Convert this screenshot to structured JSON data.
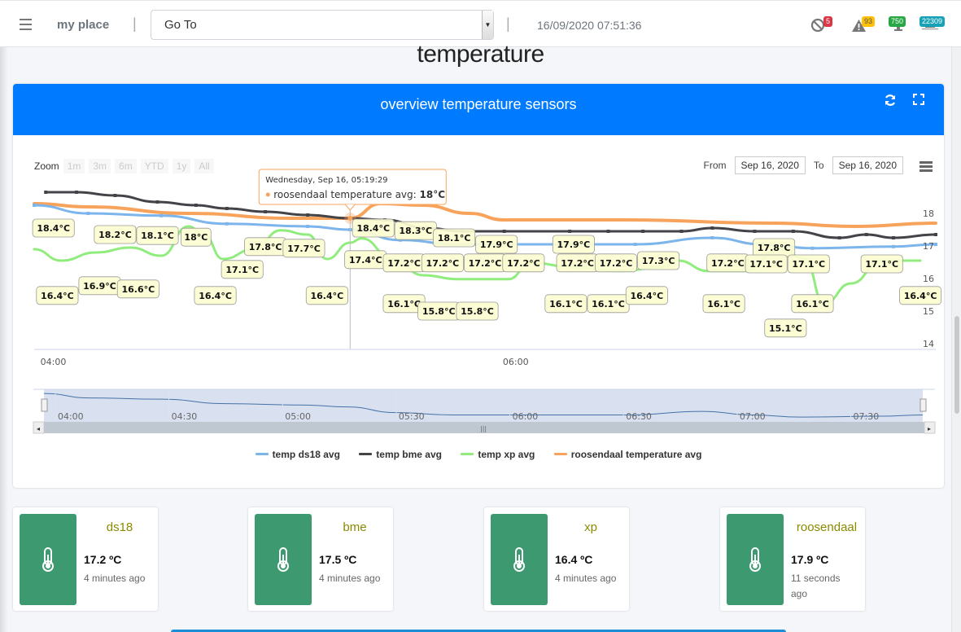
{
  "topbar": {
    "brand": "my place",
    "separator": "|",
    "goto_value": "Go To",
    "clock": "16/09/2020 07:51:36",
    "indicators": [
      {
        "icon": "ban-icon",
        "count": "5",
        "color": "#dc3545"
      },
      {
        "icon": "warning-icon",
        "count": "93",
        "color": "#ffc107"
      },
      {
        "icon": "node-icon",
        "count": "750",
        "color": "#28a745"
      },
      {
        "icon": "monitor-icon",
        "count": "22309",
        "color": "#17a2b8"
      }
    ]
  },
  "page": {
    "title": "temperature"
  },
  "panel": {
    "title": "overview temperature sensors",
    "zoom_label": "Zoom",
    "zoom_buttons": [
      "1m",
      "3m",
      "6m",
      "YTD",
      "1y",
      "All"
    ],
    "from_label": "From",
    "from_value": "Sep 16, 2020",
    "to_label": "To",
    "to_value": "Sep 16, 2020"
  },
  "tooltip": {
    "header": "Wednesday, Sep 16, 05:19:29",
    "series": "roosendaal temperature avg: ",
    "value": "18°C",
    "time": "05:19"
  },
  "chart_data": {
    "type": "line",
    "title": "overview temperature sensors",
    "xlabel": "",
    "ylabel": "",
    "x_range": [
      "03:55",
      "07:49"
    ],
    "x_ticks": [
      "04:00",
      "06:00"
    ],
    "ylim": [
      14,
      18.8
    ],
    "y_ticks": [
      14,
      15,
      16,
      17,
      18
    ],
    "grid": false,
    "legend_position": "bottom-center",
    "navigator_ticks": [
      "04:00",
      "04:30",
      "05:00",
      "05:30",
      "06:00",
      "06:30",
      "07:00",
      "07:30"
    ],
    "series": [
      {
        "name": "temp ds18 avg",
        "color": "#7cb5ec",
        "x": [
          "03:55",
          "04:09",
          "04:28",
          "04:45",
          "05:06",
          "05:17",
          "05:30",
          "05:45",
          "05:58",
          "06:31",
          "06:51",
          "07:04",
          "07:17",
          "07:38",
          "07:49"
        ],
        "values": [
          18.25,
          18.0,
          17.93,
          17.68,
          17.6,
          17.5,
          17.18,
          17.05,
          17.05,
          17.05,
          17.25,
          17.05,
          16.93,
          16.98,
          17.05
        ]
      },
      {
        "name": "temp bme avg",
        "color": "#434348",
        "x": [
          "03:58",
          "04:06",
          "04:16",
          "04:27",
          "04:37",
          "04:45",
          "04:55",
          "05:06",
          "05:17",
          "05:26",
          "05:37",
          "05:46",
          "05:57",
          "06:14",
          "06:24",
          "06:33",
          "06:43",
          "06:51",
          "07:02",
          "07:12",
          "07:24",
          "07:31",
          "07:38",
          "07:49"
        ],
        "values": [
          18.65,
          18.65,
          18.55,
          18.35,
          18.25,
          18.15,
          18.05,
          17.95,
          17.85,
          17.8,
          17.55,
          17.45,
          17.45,
          17.45,
          17.45,
          17.45,
          17.45,
          17.55,
          17.45,
          17.45,
          17.25,
          17.35,
          17.25,
          17.35
        ]
      },
      {
        "name": "temp xp avg",
        "color": "#90ed7d",
        "x": [
          "03:55",
          "04:02",
          "04:11",
          "04:20",
          "04:28",
          "04:35",
          "04:39",
          "04:44",
          "04:52",
          "04:59",
          "05:06",
          "05:11",
          "05:17",
          "05:20",
          "05:28",
          "05:36",
          "05:45",
          "05:58",
          "06:04",
          "06:15",
          "06:27",
          "06:38",
          "06:42",
          "06:50",
          "06:59",
          "07:09",
          "07:15",
          "07:20",
          "07:27",
          "07:35",
          "07:45"
        ],
        "values": [
          16.9,
          16.55,
          16.8,
          16.95,
          16.7,
          17.6,
          17.35,
          16.6,
          16.9,
          17.48,
          17.35,
          16.6,
          17.1,
          17.23,
          16.6,
          16.1,
          15.98,
          15.98,
          16.48,
          16.35,
          16.23,
          16.35,
          16.55,
          16.23,
          16.23,
          16.9,
          16.6,
          15.23,
          15.85,
          16.55,
          16.55
        ]
      },
      {
        "name": "roosendaal temperature avg",
        "color": "#f7a35c",
        "x": [
          "03:55",
          "04:09",
          "04:35",
          "05:02",
          "05:17",
          "05:25",
          "05:36",
          "05:48",
          "05:57",
          "06:28",
          "07:07",
          "07:28",
          "07:49"
        ],
        "values": [
          18.3,
          18.2,
          18.0,
          17.85,
          17.85,
          18.3,
          18.25,
          18.0,
          17.8,
          17.8,
          17.7,
          17.6,
          17.7
        ]
      }
    ],
    "data_labels": [
      {
        "text": "18.4°C",
        "x": "04:00",
        "v": 17.55
      },
      {
        "text": "18.2°C",
        "x": "04:16",
        "v": 17.35
      },
      {
        "text": "18.1°C",
        "x": "04:27",
        "v": 17.32
      },
      {
        "text": "18°C",
        "x": "04:37",
        "v": 17.27
      },
      {
        "text": "17.8°C",
        "x": "04:55",
        "v": 16.98
      },
      {
        "text": "17.7°C",
        "x": "05:05",
        "v": 16.93
      },
      {
        "text": "18.4°C",
        "x": "05:23",
        "v": 17.55
      },
      {
        "text": "18.3°C",
        "x": "05:34",
        "v": 17.47
      },
      {
        "text": "18.1°C",
        "x": "05:44",
        "v": 17.25
      },
      {
        "text": "17.9°C",
        "x": "05:55",
        "v": 17.05
      },
      {
        "text": "17.9°C",
        "x": "06:15",
        "v": 17.05
      },
      {
        "text": "17.8°C",
        "x": "07:07",
        "v": 16.95
      },
      {
        "text": "16.4°C",
        "x": "04:01",
        "v": 15.48
      },
      {
        "text": "16.9°C",
        "x": "04:12",
        "v": 15.78
      },
      {
        "text": "16.6°C",
        "x": "04:22",
        "v": 15.68
      },
      {
        "text": "17.1°C",
        "x": "04:49",
        "v": 16.28
      },
      {
        "text": "16.4°C",
        "x": "04:42",
        "v": 15.48
      },
      {
        "text": "16.4°C",
        "x": "05:11",
        "v": 15.48
      },
      {
        "text": "17.4°C",
        "x": "05:21",
        "v": 16.58
      },
      {
        "text": "17.2°C",
        "x": "05:31",
        "v": 16.48
      },
      {
        "text": "17.2°C",
        "x": "05:41",
        "v": 16.48
      },
      {
        "text": "17.2°C",
        "x": "05:52",
        "v": 16.48
      },
      {
        "text": "17.2°C",
        "x": "06:02",
        "v": 16.48
      },
      {
        "text": "17.2°C",
        "x": "06:16",
        "v": 16.48
      },
      {
        "text": "17.2°C",
        "x": "06:26",
        "v": 16.48
      },
      {
        "text": "17.3°C",
        "x": "06:37",
        "v": 16.55
      },
      {
        "text": "17.2°C",
        "x": "06:55",
        "v": 16.48
      },
      {
        "text": "17.1°C",
        "x": "07:05",
        "v": 16.45
      },
      {
        "text": "17.1°C",
        "x": "07:16",
        "v": 16.45
      },
      {
        "text": "17.1°C",
        "x": "07:35",
        "v": 16.45
      },
      {
        "text": "16.1°C",
        "x": "05:31",
        "v": 15.23
      },
      {
        "text": "15.8°C",
        "x": "05:40",
        "v": 15.0
      },
      {
        "text": "15.8°C",
        "x": "05:50",
        "v": 15.0
      },
      {
        "text": "16.1°C",
        "x": "06:13",
        "v": 15.23
      },
      {
        "text": "16.1°C",
        "x": "06:24",
        "v": 15.23
      },
      {
        "text": "16.4°C",
        "x": "06:34",
        "v": 15.48
      },
      {
        "text": "16.1°C",
        "x": "06:54",
        "v": 15.23
      },
      {
        "text": "16.1°C",
        "x": "07:17",
        "v": 15.23
      },
      {
        "text": "15.1°C",
        "x": "07:10",
        "v": 14.48
      },
      {
        "text": "16.4°C",
        "x": "07:45",
        "v": 15.48
      }
    ]
  },
  "sensors": [
    {
      "name": "ds18",
      "value": "17.2 ºC",
      "ago": "4 minutes ago"
    },
    {
      "name": "bme",
      "value": "17.5 ºC",
      "ago": "4 minutes ago"
    },
    {
      "name": "xp",
      "value": "16.4 ºC",
      "ago": "4 minutes ago"
    },
    {
      "name": "roosendaal",
      "value": "17.9 ºC",
      "ago": "11 seconds ago"
    }
  ]
}
